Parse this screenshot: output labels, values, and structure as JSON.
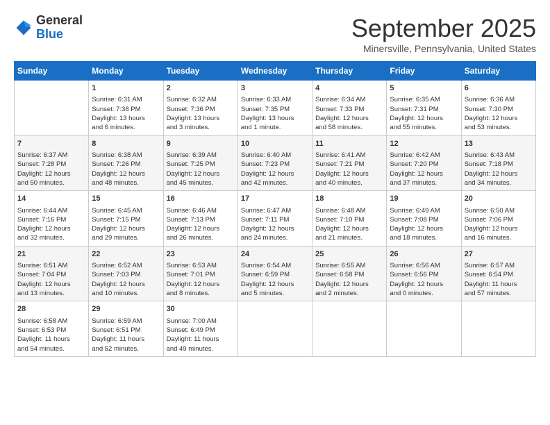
{
  "header": {
    "logo_general": "General",
    "logo_blue": "Blue",
    "month": "September 2025",
    "location": "Minersville, Pennsylvania, United States"
  },
  "days_of_week": [
    "Sunday",
    "Monday",
    "Tuesday",
    "Wednesday",
    "Thursday",
    "Friday",
    "Saturday"
  ],
  "weeks": [
    [
      {
        "day": "",
        "info": ""
      },
      {
        "day": "1",
        "info": "Sunrise: 6:31 AM\nSunset: 7:38 PM\nDaylight: 13 hours\nand 6 minutes."
      },
      {
        "day": "2",
        "info": "Sunrise: 6:32 AM\nSunset: 7:36 PM\nDaylight: 13 hours\nand 3 minutes."
      },
      {
        "day": "3",
        "info": "Sunrise: 6:33 AM\nSunset: 7:35 PM\nDaylight: 13 hours\nand 1 minute."
      },
      {
        "day": "4",
        "info": "Sunrise: 6:34 AM\nSunset: 7:33 PM\nDaylight: 12 hours\nand 58 minutes."
      },
      {
        "day": "5",
        "info": "Sunrise: 6:35 AM\nSunset: 7:31 PM\nDaylight: 12 hours\nand 55 minutes."
      },
      {
        "day": "6",
        "info": "Sunrise: 6:36 AM\nSunset: 7:30 PM\nDaylight: 12 hours\nand 53 minutes."
      }
    ],
    [
      {
        "day": "7",
        "info": "Sunrise: 6:37 AM\nSunset: 7:28 PM\nDaylight: 12 hours\nand 50 minutes."
      },
      {
        "day": "8",
        "info": "Sunrise: 6:38 AM\nSunset: 7:26 PM\nDaylight: 12 hours\nand 48 minutes."
      },
      {
        "day": "9",
        "info": "Sunrise: 6:39 AM\nSunset: 7:25 PM\nDaylight: 12 hours\nand 45 minutes."
      },
      {
        "day": "10",
        "info": "Sunrise: 6:40 AM\nSunset: 7:23 PM\nDaylight: 12 hours\nand 42 minutes."
      },
      {
        "day": "11",
        "info": "Sunrise: 6:41 AM\nSunset: 7:21 PM\nDaylight: 12 hours\nand 40 minutes."
      },
      {
        "day": "12",
        "info": "Sunrise: 6:42 AM\nSunset: 7:20 PM\nDaylight: 12 hours\nand 37 minutes."
      },
      {
        "day": "13",
        "info": "Sunrise: 6:43 AM\nSunset: 7:18 PM\nDaylight: 12 hours\nand 34 minutes."
      }
    ],
    [
      {
        "day": "14",
        "info": "Sunrise: 6:44 AM\nSunset: 7:16 PM\nDaylight: 12 hours\nand 32 minutes."
      },
      {
        "day": "15",
        "info": "Sunrise: 6:45 AM\nSunset: 7:15 PM\nDaylight: 12 hours\nand 29 minutes."
      },
      {
        "day": "16",
        "info": "Sunrise: 6:46 AM\nSunset: 7:13 PM\nDaylight: 12 hours\nand 26 minutes."
      },
      {
        "day": "17",
        "info": "Sunrise: 6:47 AM\nSunset: 7:11 PM\nDaylight: 12 hours\nand 24 minutes."
      },
      {
        "day": "18",
        "info": "Sunrise: 6:48 AM\nSunset: 7:10 PM\nDaylight: 12 hours\nand 21 minutes."
      },
      {
        "day": "19",
        "info": "Sunrise: 6:49 AM\nSunset: 7:08 PM\nDaylight: 12 hours\nand 18 minutes."
      },
      {
        "day": "20",
        "info": "Sunrise: 6:50 AM\nSunset: 7:06 PM\nDaylight: 12 hours\nand 16 minutes."
      }
    ],
    [
      {
        "day": "21",
        "info": "Sunrise: 6:51 AM\nSunset: 7:04 PM\nDaylight: 12 hours\nand 13 minutes."
      },
      {
        "day": "22",
        "info": "Sunrise: 6:52 AM\nSunset: 7:03 PM\nDaylight: 12 hours\nand 10 minutes."
      },
      {
        "day": "23",
        "info": "Sunrise: 6:53 AM\nSunset: 7:01 PM\nDaylight: 12 hours\nand 8 minutes."
      },
      {
        "day": "24",
        "info": "Sunrise: 6:54 AM\nSunset: 6:59 PM\nDaylight: 12 hours\nand 5 minutes."
      },
      {
        "day": "25",
        "info": "Sunrise: 6:55 AM\nSunset: 6:58 PM\nDaylight: 12 hours\nand 2 minutes."
      },
      {
        "day": "26",
        "info": "Sunrise: 6:56 AM\nSunset: 6:56 PM\nDaylight: 12 hours\nand 0 minutes."
      },
      {
        "day": "27",
        "info": "Sunrise: 6:57 AM\nSunset: 6:54 PM\nDaylight: 11 hours\nand 57 minutes."
      }
    ],
    [
      {
        "day": "28",
        "info": "Sunrise: 6:58 AM\nSunset: 6:53 PM\nDaylight: 11 hours\nand 54 minutes."
      },
      {
        "day": "29",
        "info": "Sunrise: 6:59 AM\nSunset: 6:51 PM\nDaylight: 11 hours\nand 52 minutes."
      },
      {
        "day": "30",
        "info": "Sunrise: 7:00 AM\nSunset: 6:49 PM\nDaylight: 11 hours\nand 49 minutes."
      },
      {
        "day": "",
        "info": ""
      },
      {
        "day": "",
        "info": ""
      },
      {
        "day": "",
        "info": ""
      },
      {
        "day": "",
        "info": ""
      }
    ]
  ]
}
